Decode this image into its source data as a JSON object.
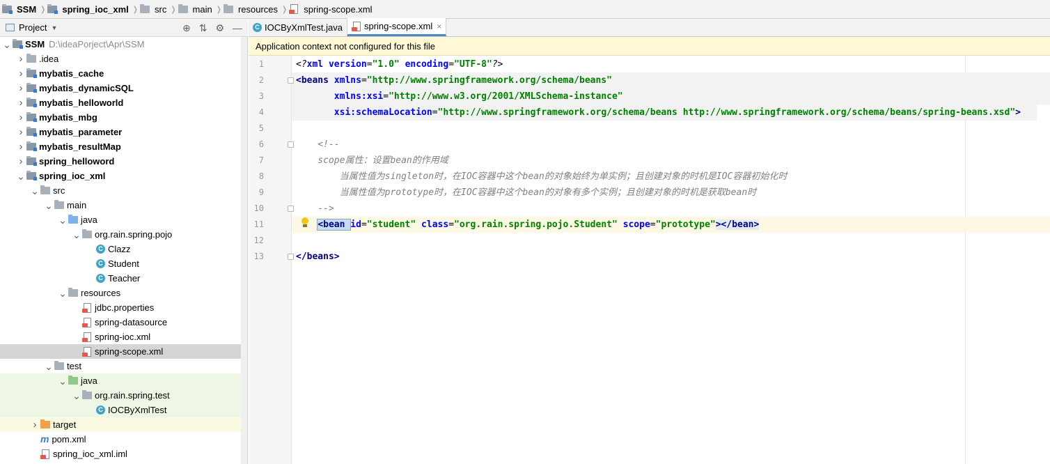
{
  "breadcrumb": [
    {
      "label": "SSM",
      "icon": "module-folder-icon",
      "bold": true
    },
    {
      "label": "spring_ioc_xml",
      "icon": "module-folder-icon",
      "bold": true
    },
    {
      "label": "src",
      "icon": "folder-icon"
    },
    {
      "label": "main",
      "icon": "folder-icon"
    },
    {
      "label": "resources",
      "icon": "resources-folder-icon"
    },
    {
      "label": "spring-scope.xml",
      "icon": "xml-file-icon"
    }
  ],
  "project_panel": {
    "title": "Project",
    "tools": [
      "target-icon",
      "collapse-icon",
      "gear-icon",
      "minimize-icon"
    ]
  },
  "tree": [
    {
      "label": "SSM",
      "path": "D:\\ideaPorject\\Apr\\SSM",
      "depth": 0,
      "expanded": true,
      "icon": "module",
      "bold": true
    },
    {
      "label": ".idea",
      "depth": 1,
      "expanded": false,
      "icon": "folder"
    },
    {
      "label": "mybatis_cache",
      "depth": 1,
      "expanded": false,
      "icon": "module",
      "bold": true
    },
    {
      "label": "mybatis_dynamicSQL",
      "depth": 1,
      "expanded": false,
      "icon": "module",
      "bold": true
    },
    {
      "label": "mybatis_helloworld",
      "depth": 1,
      "expanded": false,
      "icon": "module",
      "bold": true
    },
    {
      "label": "mybatis_mbg",
      "depth": 1,
      "expanded": false,
      "icon": "module",
      "bold": true
    },
    {
      "label": "mybatis_parameter",
      "depth": 1,
      "expanded": false,
      "icon": "module",
      "bold": true
    },
    {
      "label": "mybatis_resultMap",
      "depth": 1,
      "expanded": false,
      "icon": "module",
      "bold": true
    },
    {
      "label": "spring_helloword",
      "depth": 1,
      "expanded": false,
      "icon": "module",
      "bold": true
    },
    {
      "label": "spring_ioc_xml",
      "depth": 1,
      "expanded": true,
      "icon": "module",
      "bold": true
    },
    {
      "label": "src",
      "depth": 2,
      "expanded": true,
      "icon": "folder"
    },
    {
      "label": "main",
      "depth": 3,
      "expanded": true,
      "icon": "folder"
    },
    {
      "label": "java",
      "depth": 4,
      "expanded": true,
      "icon": "source"
    },
    {
      "label": "org.rain.spring.pojo",
      "depth": 5,
      "expanded": true,
      "icon": "package"
    },
    {
      "label": "Clazz",
      "depth": 6,
      "icon": "class"
    },
    {
      "label": "Student",
      "depth": 6,
      "icon": "class"
    },
    {
      "label": "Teacher",
      "depth": 6,
      "icon": "class"
    },
    {
      "label": "resources",
      "depth": 4,
      "expanded": true,
      "icon": "resources"
    },
    {
      "label": "jdbc.properties",
      "depth": 5,
      "icon": "properties"
    },
    {
      "label": "spring-datasource",
      "depth": 5,
      "icon": "xml"
    },
    {
      "label": "spring-ioc.xml",
      "depth": 5,
      "icon": "xml"
    },
    {
      "label": "spring-scope.xml",
      "depth": 5,
      "icon": "xml",
      "selected": true
    },
    {
      "label": "test",
      "depth": 3,
      "expanded": true,
      "icon": "folder"
    },
    {
      "label": "java",
      "depth": 4,
      "expanded": true,
      "icon": "test-source",
      "bg": "test"
    },
    {
      "label": "org.rain.spring.test",
      "depth": 5,
      "expanded": true,
      "icon": "package",
      "bg": "test"
    },
    {
      "label": "IOCByXmlTest",
      "depth": 6,
      "icon": "test-class",
      "bg": "test"
    },
    {
      "label": "target",
      "depth": 2,
      "expanded": false,
      "icon": "excluded",
      "bg": "excluded"
    },
    {
      "label": "pom.xml",
      "depth": 2,
      "icon": "maven"
    },
    {
      "label": "spring_ioc_xml.iml",
      "depth": 2,
      "icon": "iml"
    }
  ],
  "tabs": [
    {
      "label": "IOCByXmlTest.java",
      "icon": "class",
      "active": false
    },
    {
      "label": "spring-scope.xml",
      "icon": "xml",
      "active": true,
      "close": "×"
    }
  ],
  "banner": "Application context not configured for this file",
  "code_lines": [
    {
      "n": "1",
      "tokens": [
        [
          "pi",
          "<?"
        ],
        [
          "attr",
          "xml "
        ],
        [
          "attr",
          "version"
        ],
        [
          "tx",
          "="
        ],
        [
          "str",
          "\"1.0\""
        ],
        [
          "tx",
          " "
        ],
        [
          "attr",
          "encoding"
        ],
        [
          "tx",
          "="
        ],
        [
          "str",
          "\"UTF-8\""
        ],
        [
          "pi",
          "?>"
        ]
      ]
    },
    {
      "n": "2",
      "tokens": [
        [
          "tag",
          "<beans "
        ],
        [
          "attr",
          "xmlns"
        ],
        [
          "tx",
          "="
        ],
        [
          "str",
          "\"http://www.springframework.org/schema/beans\""
        ]
      ]
    },
    {
      "n": "3",
      "tokens": [
        [
          "tx",
          "       "
        ],
        [
          "attr",
          "xmlns:xsi"
        ],
        [
          "tx",
          "="
        ],
        [
          "str",
          "\"http://www.w3.org/2001/XMLSchema-instance\""
        ]
      ]
    },
    {
      "n": "4",
      "tokens": [
        [
          "tx",
          "       "
        ],
        [
          "attr",
          "xsi:schemaLocation"
        ],
        [
          "tx",
          "="
        ],
        [
          "str",
          "\"http://www.springframework.org/schema/beans http://www.springframework.org/schema/beans/spring-beans.xsd\""
        ],
        [
          "tag",
          ">"
        ]
      ]
    },
    {
      "n": "5",
      "tokens": []
    },
    {
      "n": "6",
      "tokens": [
        [
          "cmt",
          "    <!--"
        ]
      ]
    },
    {
      "n": "7",
      "tokens": [
        [
          "cmt",
          "    scope属性：设置bean的作用域"
        ]
      ]
    },
    {
      "n": "8",
      "tokens": [
        [
          "cmt",
          "        当属性值为singleton时，在IOC容器中这个bean的对象始终为单实例；且创建对象的时机是IOC容器初始化时"
        ]
      ]
    },
    {
      "n": "9",
      "tokens": [
        [
          "cmt",
          "        当属性值为prototype时，在IOC容器中这个bean的对象有多个实例；且创建对象的时机是获取bean时"
        ]
      ]
    },
    {
      "n": "10",
      "tokens": [
        [
          "cmt",
          "    -->"
        ]
      ]
    },
    {
      "n": "11",
      "tokens": [
        [
          "tx",
          "    "
        ],
        [
          "tag",
          "<bean "
        ],
        [
          "attr",
          "id"
        ],
        [
          "tx",
          "="
        ],
        [
          "str",
          "\"student\""
        ],
        [
          "tx",
          " "
        ],
        [
          "attr",
          "class"
        ],
        [
          "tx",
          "="
        ],
        [
          "str",
          "\"org.rain.spring.pojo.Student\""
        ],
        [
          "tx",
          " "
        ],
        [
          "attr",
          "scope"
        ],
        [
          "tx",
          "="
        ],
        [
          "str",
          "\"prototype\""
        ],
        [
          "tag",
          "></bean>"
        ]
      ]
    },
    {
      "n": "12",
      "tokens": []
    },
    {
      "n": "13",
      "tokens": [
        [
          "tag",
          "</beans>"
        ]
      ]
    }
  ],
  "colors": {
    "tag": "#000080",
    "attribute": "#0000ff",
    "string": "#008000",
    "comment": "#808080",
    "current_line": "#fdf8e3",
    "banner": "#fff8d6"
  }
}
